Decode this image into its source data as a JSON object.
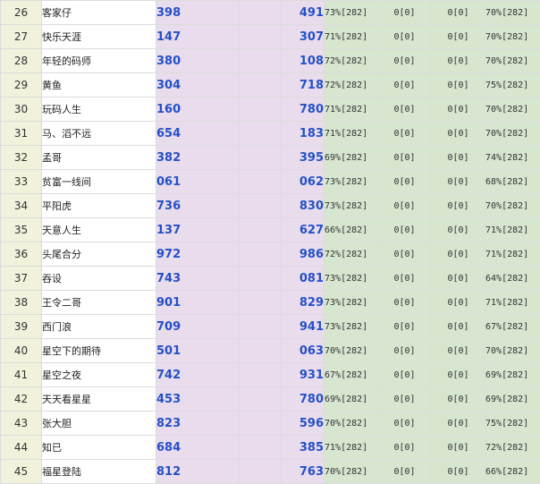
{
  "table": {
    "rows": [
      {
        "rank": "26",
        "name": "客家仔",
        "score1": "398",
        "score2": "491",
        "rate1": "73%[282]",
        "stat1": "0[0]",
        "stat2": "0[0]",
        "rate2": "70%[282]"
      },
      {
        "rank": "27",
        "name": "快乐天涯",
        "score1": "147",
        "score2": "307",
        "rate1": "71%[282]",
        "stat1": "0[0]",
        "stat2": "0[0]",
        "rate2": "70%[282]"
      },
      {
        "rank": "28",
        "name": "年轻的码师",
        "score1": "380",
        "score2": "108",
        "rate1": "72%[282]",
        "stat1": "0[0]",
        "stat2": "0[0]",
        "rate2": "70%[282]"
      },
      {
        "rank": "29",
        "name": "黄鱼",
        "score1": "304",
        "score2": "718",
        "rate1": "72%[282]",
        "stat1": "0[0]",
        "stat2": "0[0]",
        "rate2": "75%[282]"
      },
      {
        "rank": "30",
        "name": "玩码人生",
        "score1": "160",
        "score2": "780",
        "rate1": "71%[282]",
        "stat1": "0[0]",
        "stat2": "0[0]",
        "rate2": "70%[282]"
      },
      {
        "rank": "31",
        "name": "马、滔不远",
        "score1": "654",
        "score2": "183",
        "rate1": "71%[282]",
        "stat1": "0[0]",
        "stat2": "0[0]",
        "rate2": "70%[282]"
      },
      {
        "rank": "32",
        "name": "孟哥",
        "score1": "382",
        "score2": "395",
        "rate1": "69%[282]",
        "stat1": "0[0]",
        "stat2": "0[0]",
        "rate2": "74%[282]"
      },
      {
        "rank": "33",
        "name": "贫富一线间",
        "score1": "061",
        "score2": "062",
        "rate1": "73%[282]",
        "stat1": "0[0]",
        "stat2": "0[0]",
        "rate2": "68%[282]"
      },
      {
        "rank": "34",
        "name": "平阳虎",
        "score1": "736",
        "score2": "830",
        "rate1": "73%[282]",
        "stat1": "0[0]",
        "stat2": "0[0]",
        "rate2": "70%[282]"
      },
      {
        "rank": "35",
        "name": "天意人生",
        "score1": "137",
        "score2": "627",
        "rate1": "66%[282]",
        "stat1": "0[0]",
        "stat2": "0[0]",
        "rate2": "71%[282]"
      },
      {
        "rank": "36",
        "name": "头尾合分",
        "score1": "972",
        "score2": "986",
        "rate1": "72%[282]",
        "stat1": "0[0]",
        "stat2": "0[0]",
        "rate2": "71%[282]"
      },
      {
        "rank": "37",
        "name": "吞设",
        "score1": "743",
        "score2": "081",
        "rate1": "73%[282]",
        "stat1": "0[0]",
        "stat2": "0[0]",
        "rate2": "64%[282]"
      },
      {
        "rank": "38",
        "name": "王令二哥",
        "score1": "901",
        "score2": "829",
        "rate1": "73%[282]",
        "stat1": "0[0]",
        "stat2": "0[0]",
        "rate2": "71%[282]"
      },
      {
        "rank": "39",
        "name": "西门浪",
        "score1": "709",
        "score2": "941",
        "rate1": "73%[282]",
        "stat1": "0[0]",
        "stat2": "0[0]",
        "rate2": "67%[282]"
      },
      {
        "rank": "40",
        "name": "星空下的期待",
        "score1": "501",
        "score2": "063",
        "rate1": "70%[282]",
        "stat1": "0[0]",
        "stat2": "0[0]",
        "rate2": "70%[282]"
      },
      {
        "rank": "41",
        "name": "星空之夜",
        "score1": "742",
        "score2": "931",
        "rate1": "67%[282]",
        "stat1": "0[0]",
        "stat2": "0[0]",
        "rate2": "69%[282]"
      },
      {
        "rank": "42",
        "name": "天天看星星",
        "score1": "453",
        "score2": "780",
        "rate1": "69%[282]",
        "stat1": "0[0]",
        "stat2": "0[0]",
        "rate2": "69%[282]"
      },
      {
        "rank": "43",
        "name": "张大胆",
        "score1": "823",
        "score2": "596",
        "rate1": "70%[282]",
        "stat1": "0[0]",
        "stat2": "0[0]",
        "rate2": "75%[282]"
      },
      {
        "rank": "44",
        "name": "知已",
        "score1": "684",
        "score2": "385",
        "rate1": "71%[282]",
        "stat1": "0[0]",
        "stat2": "0[0]",
        "rate2": "72%[282]"
      },
      {
        "rank": "45",
        "name": "福星登陆",
        "score1": "812",
        "score2": "763",
        "rate1": "70%[282]",
        "stat1": "0[0]",
        "stat2": "0[0]",
        "rate2": "66%[282]"
      }
    ]
  }
}
